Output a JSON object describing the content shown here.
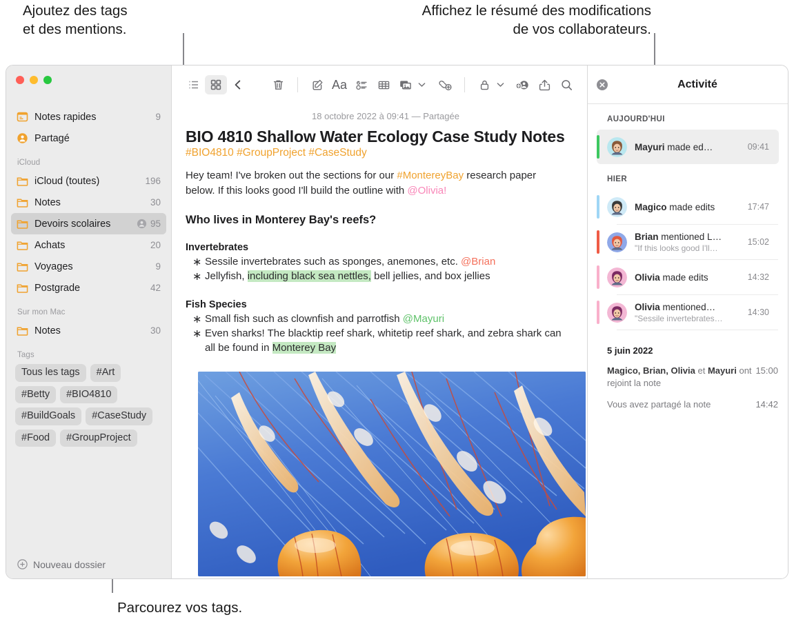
{
  "callouts": {
    "tags": "Ajoutez des tags\net des mentions.",
    "activity": "Affichez le résumé des modifications\nde vos collaborateurs.",
    "browse": "Parcourez vos tags."
  },
  "sidebar": {
    "quick": {
      "label": "Notes rapides",
      "count": "9",
      "icon": "quick-note-icon"
    },
    "shared": {
      "label": "Partagé",
      "count": "",
      "icon": "shared-person-icon"
    },
    "sections": [
      {
        "title": "iCloud",
        "items": [
          {
            "label": "iCloud (toutes)",
            "count": "196",
            "shared": false,
            "selected": false
          },
          {
            "label": "Notes",
            "count": "30",
            "shared": false,
            "selected": false
          },
          {
            "label": "Devoirs scolaires",
            "count": "95",
            "shared": true,
            "selected": true
          },
          {
            "label": "Achats",
            "count": "20",
            "shared": false,
            "selected": false
          },
          {
            "label": "Voyages",
            "count": "9",
            "shared": false,
            "selected": false
          },
          {
            "label": "Postgrade",
            "count": "42",
            "shared": false,
            "selected": false
          }
        ]
      },
      {
        "title": "Sur mon Mac",
        "items": [
          {
            "label": "Notes",
            "count": "30",
            "shared": false,
            "selected": false
          }
        ]
      }
    ],
    "tags_section_title": "Tags",
    "tags": [
      "Tous les tags",
      "#Art",
      "#Betty",
      "#BIO4810",
      "#BuildGoals",
      "#CaseStudy",
      "#Food",
      "#GroupProject"
    ],
    "new_folder": "Nouveau dossier",
    "folder_color": "#f0a22e"
  },
  "toolbar": {
    "buttons": [
      {
        "name": "list-view-icon",
        "label": ""
      },
      {
        "name": "gallery-view-icon",
        "label": ""
      },
      {
        "name": "back-chevron-icon",
        "label": ""
      },
      {
        "name": "delete-trash-icon",
        "label": ""
      },
      {
        "name": "compose-note-icon",
        "label": ""
      },
      {
        "name": "format-text-icon",
        "label": "Aa"
      },
      {
        "name": "checklist-icon",
        "label": ""
      },
      {
        "name": "table-icon",
        "label": ""
      },
      {
        "name": "media-attach-icon",
        "label": ""
      },
      {
        "name": "link-add-icon",
        "label": ""
      },
      {
        "name": "lock-icon",
        "label": ""
      },
      {
        "name": "add-collaborator-icon",
        "label": ""
      },
      {
        "name": "share-icon",
        "label": ""
      },
      {
        "name": "search-icon",
        "label": ""
      }
    ]
  },
  "note": {
    "date_line": "18 octobre 2022 à 09:41 — Partagée",
    "title": "BIO 4810 Shallow Water Ecology Case Study Notes",
    "tags_line": "#BIO4810 #GroupProject #CaseStudy",
    "intro": {
      "part1": "Hey team! I've broken out the sections for our ",
      "tag": "#MontereyBay",
      "part2": " research paper below. If this looks good I'll build the outline with ",
      "mention": "@Olivia!"
    },
    "heading": "Who lives in Monterey Bay's reefs?",
    "section1": {
      "heading": "Invertebrates",
      "b1_part1": "Sessile invertebrates such as sponges, anemones, etc. ",
      "b1_mention": "@Brian",
      "b2_part1": "Jellyfish, ",
      "b2_hl": "including black sea nettles,",
      "b2_part2": " bell jellies, and box jellies"
    },
    "section2": {
      "heading": "Fish Species",
      "b1_part1": "Small fish such as clownfish and parrotfish ",
      "b1_mention": "@Mayuri",
      "b2_part1": "Even sharks! The blacktip reef shark, whitetip reef shark, and zebra shark can all be found in ",
      "b2_hl": "Monterey Bay"
    },
    "image_alt": "jellyfish-photo"
  },
  "activity": {
    "title": "Activité",
    "close_label": "",
    "groups": [
      {
        "heading": "AUJOURD'HUI",
        "items": [
          {
            "name": "Mayuri",
            "action": " made ed…",
            "sub": "",
            "time": "09:41",
            "bar": "#3dc860",
            "avatar_bg": "#b9e7ef",
            "avatar_hair": "#8a5a3a",
            "selected": true
          }
        ]
      },
      {
        "heading": "HIER",
        "items": [
          {
            "name": "Magico",
            "action": " made edits",
            "sub": "",
            "time": "17:47",
            "bar": "#9fd6f5",
            "avatar_bg": "#cfeaf7",
            "avatar_hair": "#3b3b3b",
            "selected": false
          },
          {
            "name": "Brian",
            "action": " mentioned L…",
            "sub": "\"If this looks good I'll…",
            "time": "15:02",
            "bar": "#ef5b46",
            "avatar_bg": "#8fa8e8",
            "avatar_hair": "#e2593f",
            "selected": false
          },
          {
            "name": "Olivia",
            "action": " made edits",
            "sub": "",
            "time": "14:32",
            "bar": "#f9b0cb",
            "avatar_bg": "#f3b7d4",
            "avatar_hair": "#7c2a62",
            "selected": false
          },
          {
            "name": "Olivia",
            "action": " mentioned…",
            "sub": "\"Sessile invertebrates…",
            "time": "14:30",
            "bar": "#f9b0cb",
            "avatar_bg": "#f3b7d4",
            "avatar_hair": "#7c2a62",
            "selected": false
          }
        ]
      }
    ],
    "older": {
      "date": "5 juin 2022",
      "rows": [
        {
          "names": "Magico, Brian, Olivia",
          "mid": " et ",
          "names2": "Mayuri",
          "tail": " ont rejoint la note",
          "time": "15:00"
        },
        {
          "names": "",
          "mid": "",
          "names2": "",
          "tail": "Vous avez partagé la note",
          "time": "14:42"
        }
      ]
    }
  }
}
